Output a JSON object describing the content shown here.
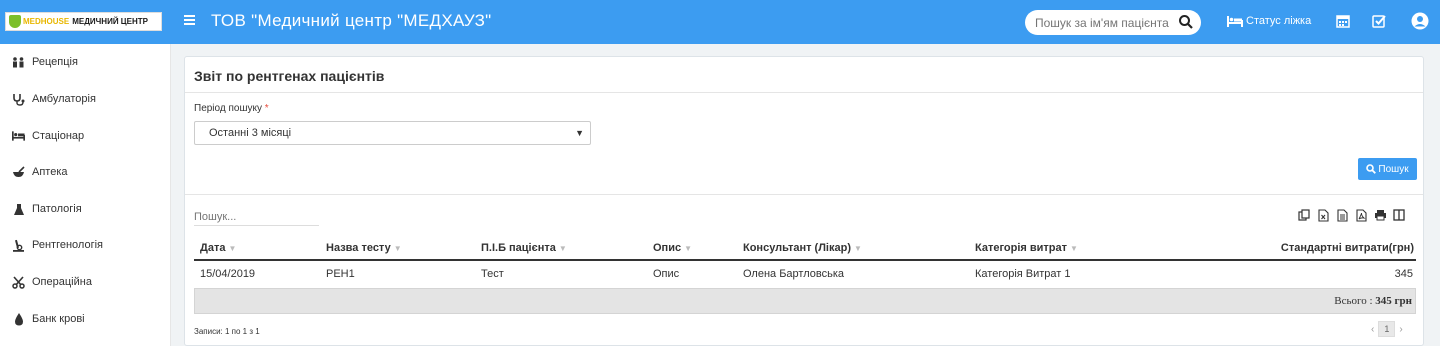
{
  "header": {
    "logo_brand": "MEDHOUSE",
    "logo_center": "МЕДИЧНИЙ ЦЕНТР",
    "org_title": "ТОВ \"Медичний центр \"МЕДХАУЗ\"",
    "search_placeholder": "Пошук за ім'ям пацієнта",
    "bed_status_label": "Статус ліжка"
  },
  "sidebar": {
    "items": [
      {
        "label": "Рецепція",
        "icon": "reception-icon"
      },
      {
        "label": "Амбулаторія",
        "icon": "stethoscope-icon"
      },
      {
        "label": "Стаціонар",
        "icon": "bed-icon"
      },
      {
        "label": "Аптека",
        "icon": "mortar-icon"
      },
      {
        "label": "Патологія",
        "icon": "flask-icon"
      },
      {
        "label": "Рентгенологія",
        "icon": "xray-icon"
      },
      {
        "label": "Операційна",
        "icon": "scissors-icon"
      },
      {
        "label": "Банк крові",
        "icon": "blood-drop-icon"
      }
    ]
  },
  "report": {
    "title": "Звіт по рентгенах пацієнтів",
    "period_label": "Період пошуку",
    "period_required_mark": "*",
    "period_value": "Останні 3 місяці",
    "search_button": "Пошук",
    "filter_placeholder": "Пошук..."
  },
  "table": {
    "columns": [
      "Дата",
      "Назва тесту",
      "П.І.Б пацієнта",
      "Опис",
      "Консультант (Лікар)",
      "Категорія витрат",
      "Стандартні витрати(грн)"
    ],
    "rows": [
      {
        "date": "15/04/2019",
        "test": "РЕН1",
        "patient": "Тест",
        "desc": "Опис",
        "doctor": "Олена Бартловська",
        "category": "Категорія Витрат 1",
        "cost": "345"
      }
    ],
    "total_label": "Всього :",
    "total_value": "345 грн",
    "records_info": "Записи: 1 по 1 з 1",
    "current_page": "1"
  },
  "colors": {
    "primary": "#3c9cf1",
    "total_bg": "#e4e4e4",
    "required": "#e74c3c"
  }
}
